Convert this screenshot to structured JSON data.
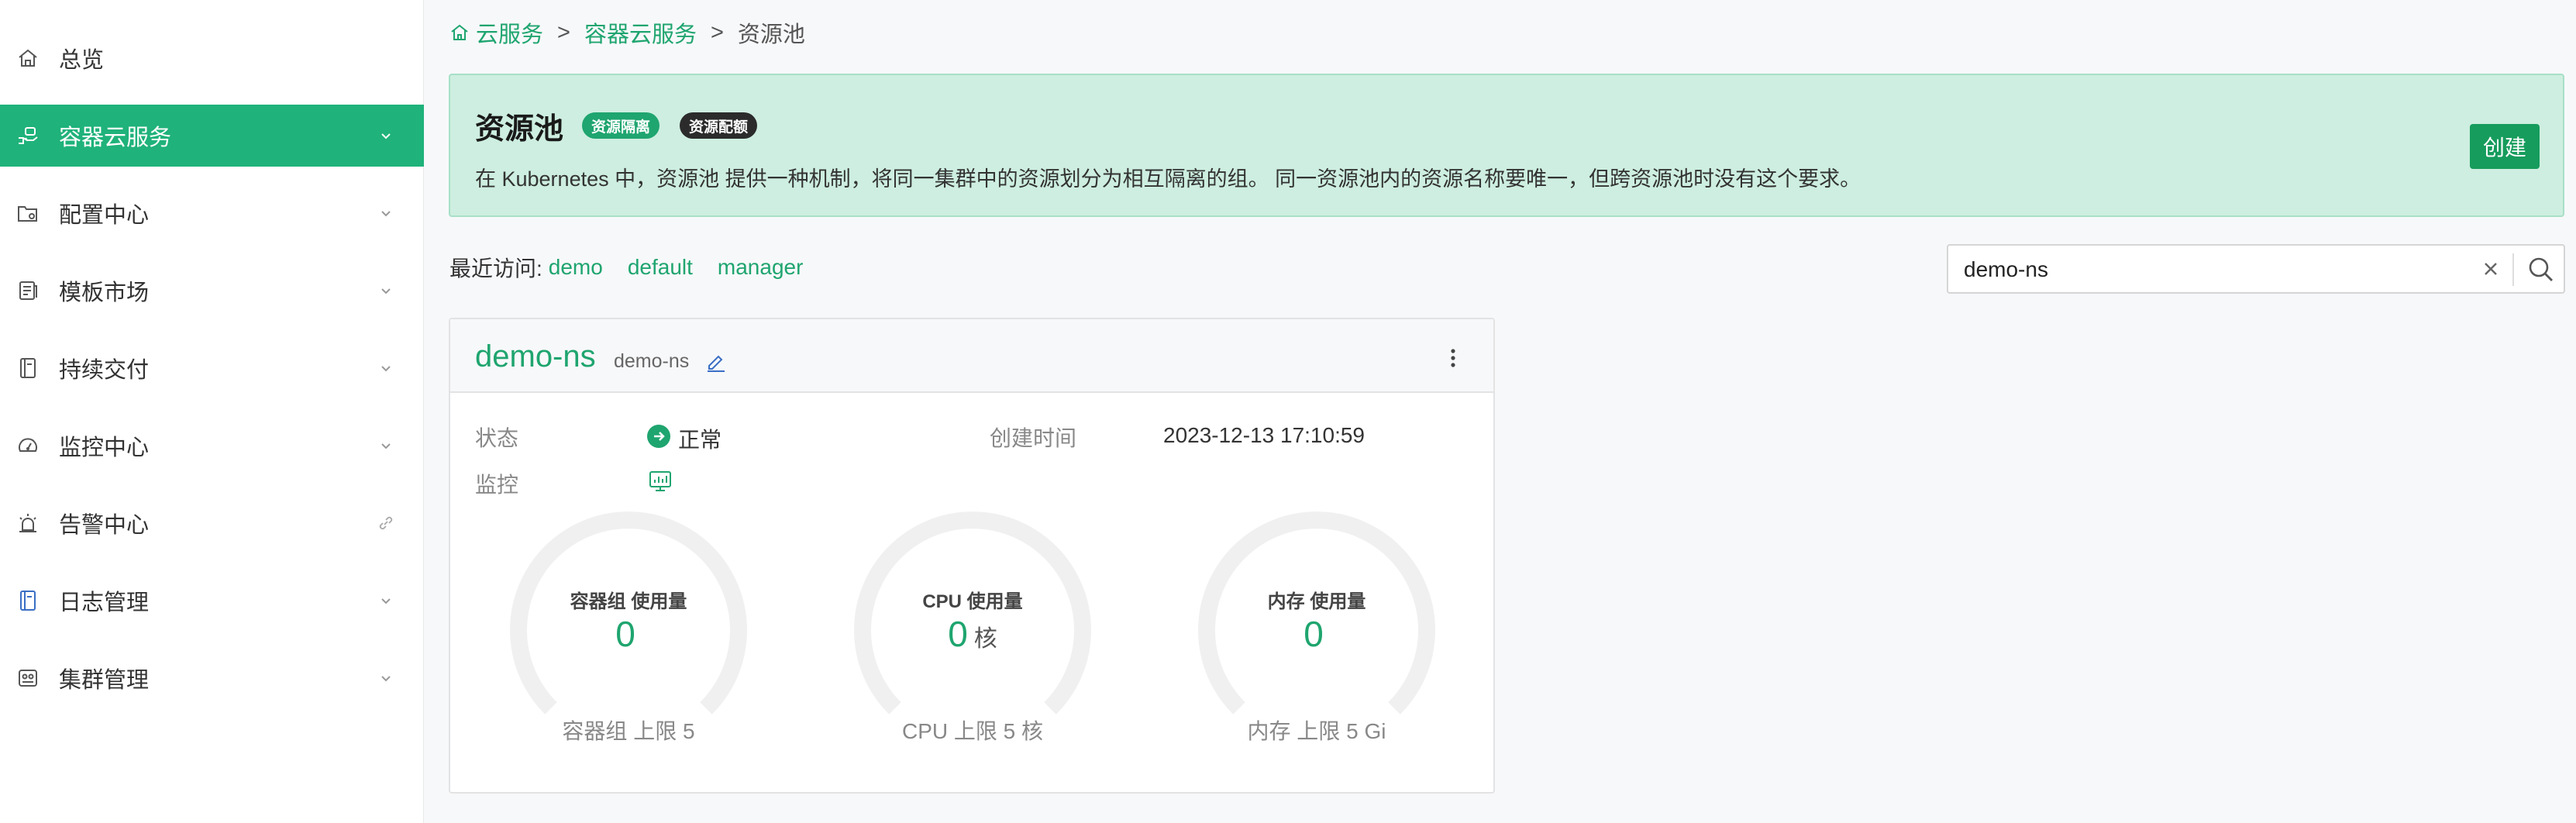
{
  "sidebar": {
    "items": [
      {
        "label": "总览",
        "icon": "home-icon",
        "active": false,
        "trailing": "none"
      },
      {
        "label": "容器云服务",
        "icon": "cloud-hand-icon",
        "active": true,
        "trailing": "chevron"
      },
      {
        "label": "配置中心",
        "icon": "folder-config-icon",
        "active": false,
        "trailing": "chevron"
      },
      {
        "label": "模板市场",
        "icon": "template-icon",
        "active": false,
        "trailing": "chevron"
      },
      {
        "label": "持续交付",
        "icon": "book-icon",
        "active": false,
        "trailing": "chevron"
      },
      {
        "label": "监控中心",
        "icon": "dashboard-icon",
        "active": false,
        "trailing": "chevron"
      },
      {
        "label": "告警中心",
        "icon": "alarm-icon",
        "active": false,
        "trailing": "link"
      },
      {
        "label": "日志管理",
        "icon": "log-icon",
        "active": false,
        "trailing": "chevron"
      },
      {
        "label": "集群管理",
        "icon": "cluster-icon",
        "active": false,
        "trailing": "chevron"
      }
    ]
  },
  "breadcrumb": {
    "items": [
      "云服务",
      "容器云服务",
      "资源池"
    ],
    "separator": ">"
  },
  "banner": {
    "title": "资源池",
    "tags": [
      "资源隔离",
      "资源配额"
    ],
    "description": "在 Kubernetes 中，资源池 提供一种机制，将同一集群中的资源划分为相互隔离的组。 同一资源池内的资源名称要唯一，但跨资源池时没有这个要求。",
    "create_label": "创建"
  },
  "recent": {
    "label": "最近访问:",
    "links": [
      "demo",
      "default",
      "manager"
    ]
  },
  "search": {
    "value": "demo-ns"
  },
  "card": {
    "name": "demo-ns",
    "subname": "demo-ns",
    "status_label": "状态",
    "status_value": "正常",
    "created_label": "创建时间",
    "created_value": "2023-12-13 17:10:59",
    "monitor_label": "监控",
    "gauges": [
      {
        "title": "容器组 使用量",
        "value": "0",
        "unit": "",
        "limit": "容器组 上限 5"
      },
      {
        "title": "CPU 使用量",
        "value": "0",
        "unit": "核",
        "limit": "CPU 上限 5 核"
      },
      {
        "title": "内存 使用量",
        "value": "0",
        "unit": "",
        "limit": "内存 上限 5 Gi"
      }
    ]
  },
  "colors": {
    "accent": "#1fa56f",
    "active_menu": "#1fb27a",
    "banner_bg": "#cdeee0",
    "create_button": "#169c5c"
  }
}
